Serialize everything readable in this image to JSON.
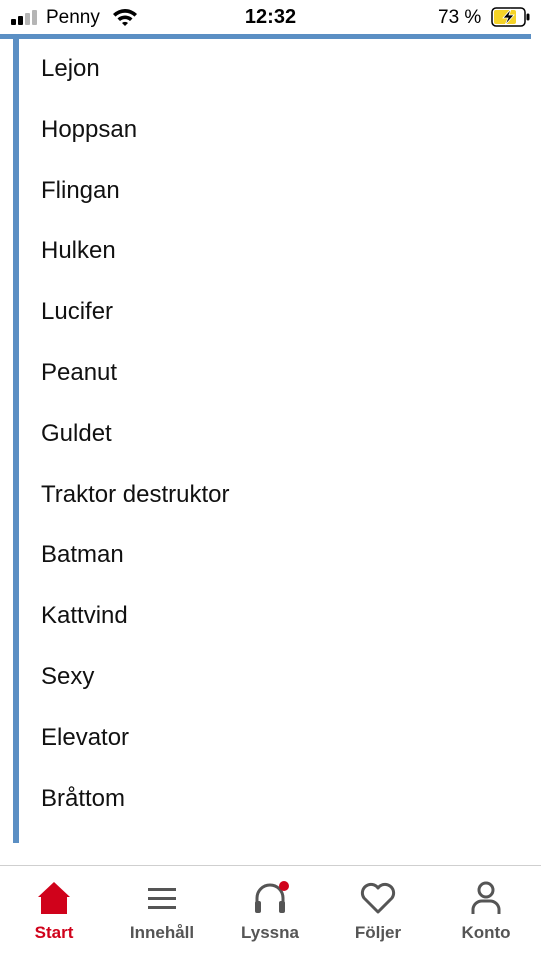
{
  "status_bar": {
    "carrier": "Penny",
    "time": "12:32",
    "battery_percent": "73 %",
    "signal_bars_active": 2,
    "signal_bars_total": 4,
    "battery_charging": true
  },
  "list": {
    "items": [
      {
        "label": "Lejon"
      },
      {
        "label": "Hoppsan"
      },
      {
        "label": "Flingan"
      },
      {
        "label": "Hulken"
      },
      {
        "label": "Lucifer"
      },
      {
        "label": "Peanut"
      },
      {
        "label": "Guldet"
      },
      {
        "label": "Traktor destruktor"
      },
      {
        "label": "Batman"
      },
      {
        "label": "Kattvind"
      },
      {
        "label": "Sexy"
      },
      {
        "label": "Elevator"
      },
      {
        "label": "Bråttom"
      }
    ]
  },
  "bottom_nav": {
    "items": [
      {
        "label": "Start",
        "icon": "home-icon",
        "active": true
      },
      {
        "label": "Innehåll",
        "icon": "menu-icon",
        "active": false
      },
      {
        "label": "Lyssna",
        "icon": "headphones-icon",
        "active": false,
        "badge": true
      },
      {
        "label": "Följer",
        "icon": "heart-icon",
        "active": false
      },
      {
        "label": "Konto",
        "icon": "user-icon",
        "active": false
      }
    ]
  },
  "colors": {
    "accent_blue": "#5b8fc4",
    "active_red": "#d0021b",
    "nav_gray": "#555555",
    "battery_yellow": "#f5d327"
  }
}
